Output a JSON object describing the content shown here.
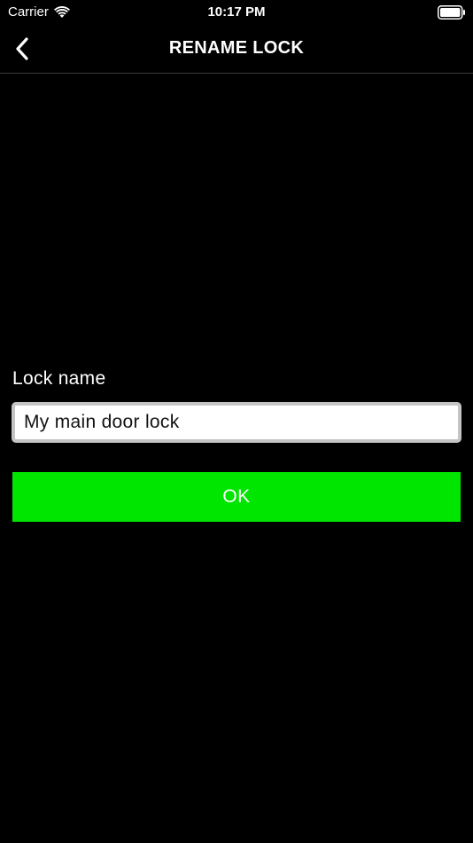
{
  "status_bar": {
    "carrier": "Carrier",
    "time": "10:17 PM",
    "wifi_icon": "wifi-icon",
    "battery_icon": "battery-full-icon"
  },
  "nav": {
    "title": "RENAME LOCK",
    "back_icon": "chevron-left-icon"
  },
  "form": {
    "label": "Lock name",
    "input_value": "My main door lock",
    "ok_label": "OK"
  },
  "colors": {
    "background": "#000000",
    "ok_button": "#00e600",
    "cursor": "#2b5cff"
  }
}
